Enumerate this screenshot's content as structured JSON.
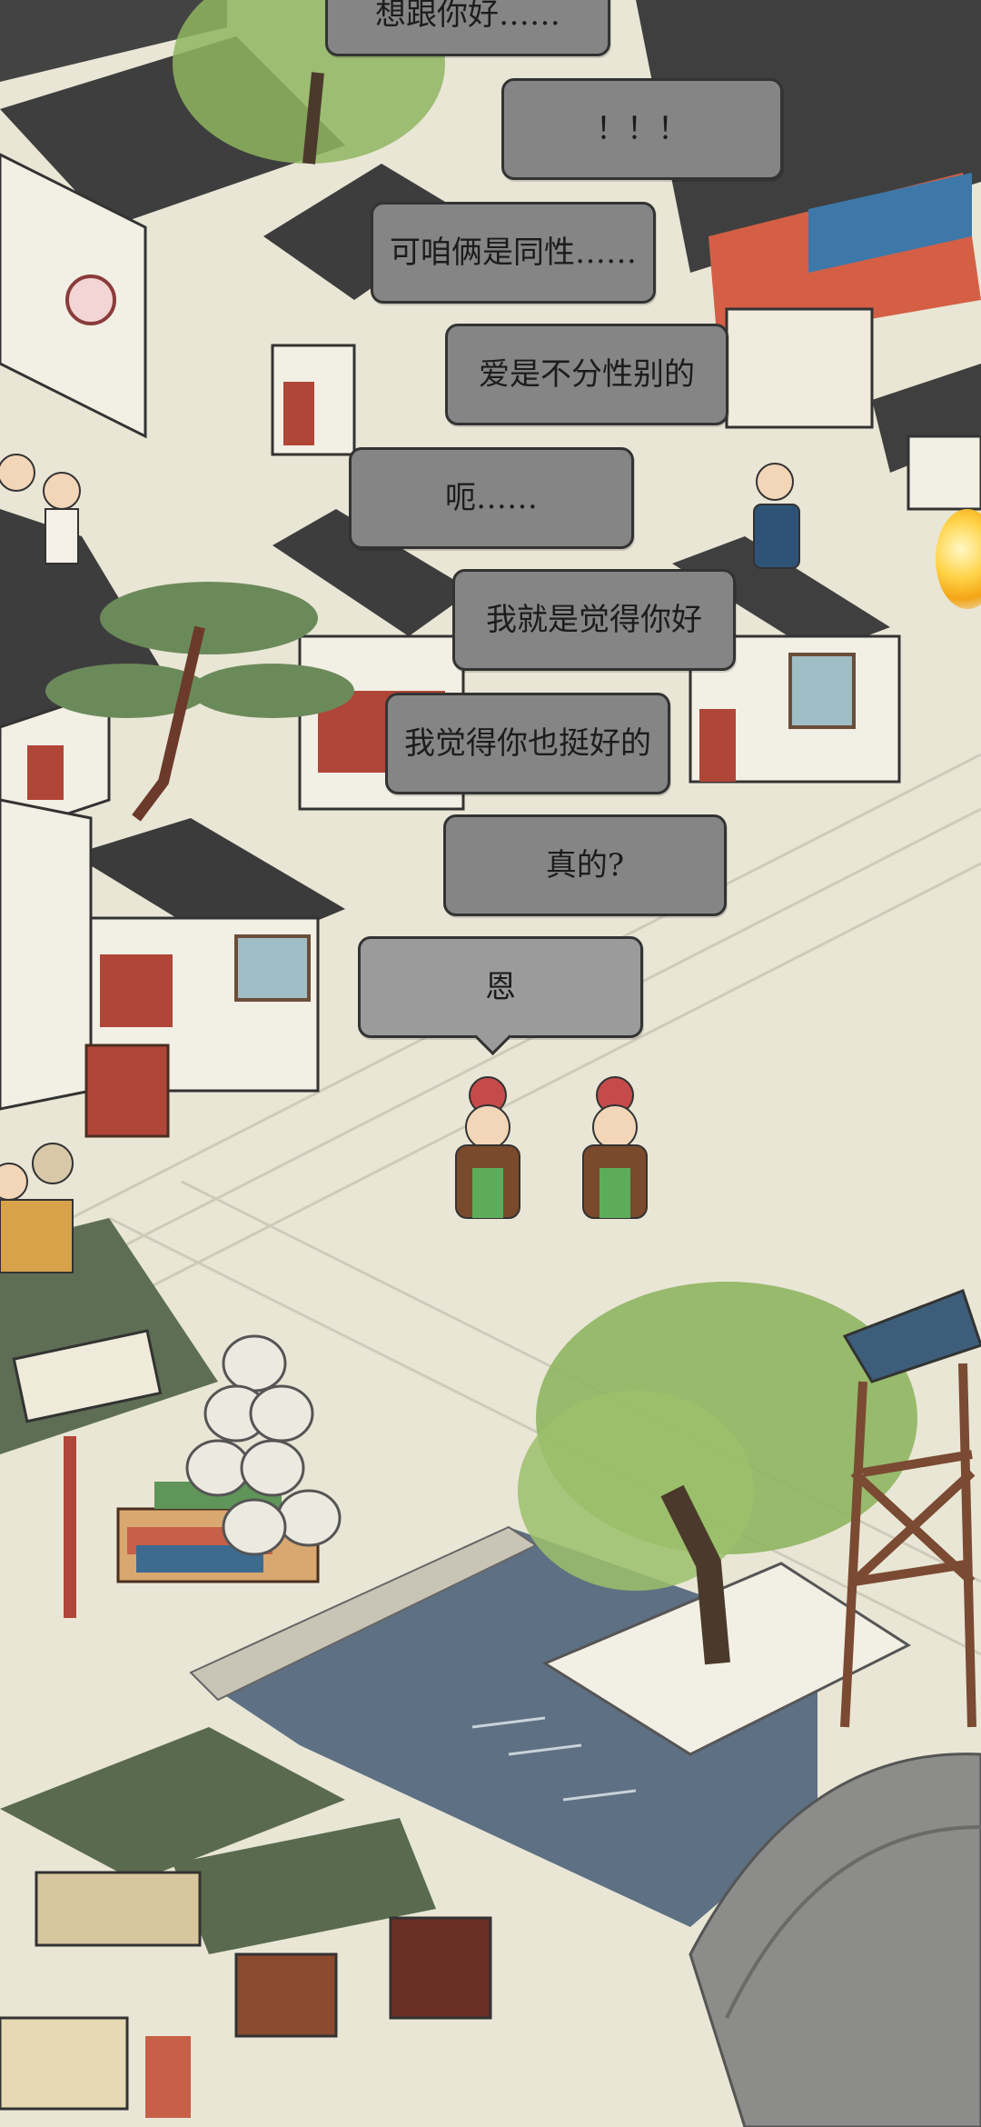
{
  "dialogue": [
    {
      "id": "b1",
      "text": "想跟你好……"
    },
    {
      "id": "b2",
      "text": "！！！"
    },
    {
      "id": "b3",
      "text": "可咱俩是同性……"
    },
    {
      "id": "b4",
      "text": "爱是不分性别的"
    },
    {
      "id": "b5",
      "text": "呃……"
    },
    {
      "id": "b6",
      "text": "我就是觉得你好"
    },
    {
      "id": "b7",
      "text": "我觉得你也挺好的"
    },
    {
      "id": "b8",
      "text": "真的?"
    },
    {
      "id": "b9",
      "text": "恩"
    }
  ],
  "icons": {
    "orb": "gold-coin-icon"
  },
  "colors": {
    "ground": "#e9e6d6",
    "roof": "#3f3f3f",
    "wall": "#f3f1e6",
    "water": "#5e7083",
    "willow": "#8fb560",
    "bubble": "#858585"
  }
}
